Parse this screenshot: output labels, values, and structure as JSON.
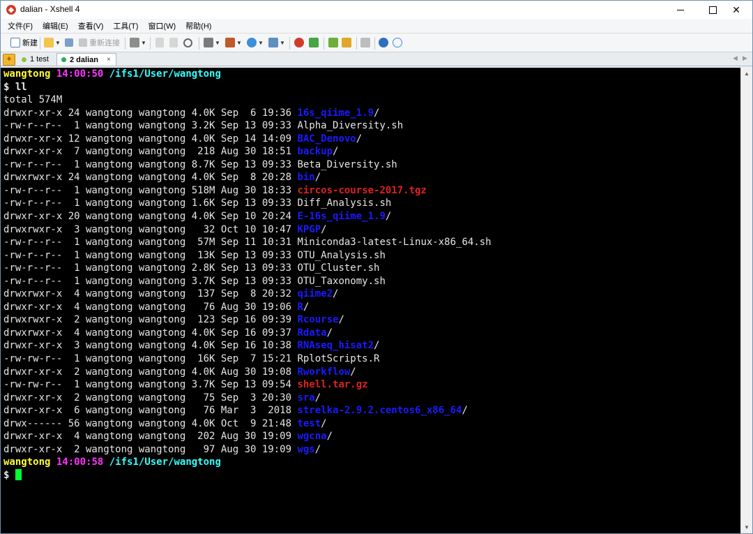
{
  "window": {
    "title": "dalian - Xshell 4"
  },
  "menu": [
    "文件(F)",
    "编辑(E)",
    "查看(V)",
    "工具(T)",
    "窗口(W)",
    "帮助(H)"
  ],
  "toolbar": {
    "new_label": "新建",
    "reconnect_label": "重新连接"
  },
  "tabs": [
    {
      "label": "1 test",
      "status_color": "#8cc63f"
    },
    {
      "label": "2 dalian",
      "status_color": "#22b14c",
      "close": "×"
    }
  ],
  "terminal": {
    "prompt_start": {
      "user": "wangtong",
      "time": "14:00:50",
      "path": "/ifs1/User/wangtong"
    },
    "command": "$ ll",
    "total": "total 574M",
    "listing": [
      {
        "meta": "drwxr-xr-x 24 wangtong wangtong 4.0K Sep  6 19:36 ",
        "name": "16s_qiime_1.9",
        "suffix": "/",
        "kind": "dir"
      },
      {
        "meta": "-rw-r--r--  1 wangtong wangtong 3.2K Sep 13 09:33 ",
        "name": "Alpha_Diversity.sh",
        "suffix": "",
        "kind": "file"
      },
      {
        "meta": "drwxr-xr-x 12 wangtong wangtong 4.0K Sep 14 14:09 ",
        "name": "BAC_Denovo",
        "suffix": "/",
        "kind": "dir"
      },
      {
        "meta": "drwxr-xr-x  7 wangtong wangtong  218 Aug 30 18:51 ",
        "name": "backup",
        "suffix": "/",
        "kind": "dir"
      },
      {
        "meta": "-rw-r--r--  1 wangtong wangtong 8.7K Sep 13 09:33 ",
        "name": "Beta_Diversity.sh",
        "suffix": "",
        "kind": "file"
      },
      {
        "meta": "drwxrwxr-x 24 wangtong wangtong 4.0K Sep  8 20:28 ",
        "name": "bin",
        "suffix": "/",
        "kind": "dir"
      },
      {
        "meta": "-rw-r--r--  1 wangtong wangtong 518M Aug 30 18:33 ",
        "name": "circos-course-2017.tgz",
        "suffix": "",
        "kind": "archive"
      },
      {
        "meta": "-rw-r--r--  1 wangtong wangtong 1.6K Sep 13 09:33 ",
        "name": "Diff_Analysis.sh",
        "suffix": "",
        "kind": "file"
      },
      {
        "meta": "drwxr-xr-x 20 wangtong wangtong 4.0K Sep 10 20:24 ",
        "name": "E-16s_qiime_1.9",
        "suffix": "/",
        "kind": "dir"
      },
      {
        "meta": "drwxrwxr-x  3 wangtong wangtong   32 Oct 10 10:47 ",
        "name": "KPGP",
        "suffix": "/",
        "kind": "dir"
      },
      {
        "meta": "-rw-r--r--  1 wangtong wangtong  57M Sep 11 10:31 ",
        "name": "Miniconda3-latest-Linux-x86_64.sh",
        "suffix": "",
        "kind": "file"
      },
      {
        "meta": "-rw-r--r--  1 wangtong wangtong  13K Sep 13 09:33 ",
        "name": "OTU_Analysis.sh",
        "suffix": "",
        "kind": "file"
      },
      {
        "meta": "-rw-r--r--  1 wangtong wangtong 2.8K Sep 13 09:33 ",
        "name": "OTU_Cluster.sh",
        "suffix": "",
        "kind": "file"
      },
      {
        "meta": "-rw-r--r--  1 wangtong wangtong 3.7K Sep 13 09:33 ",
        "name": "OTU_Taxonomy.sh",
        "suffix": "",
        "kind": "file"
      },
      {
        "meta": "drwxrwxr-x  4 wangtong wangtong  137 Sep  8 20:32 ",
        "name": "qiime2",
        "suffix": "/",
        "kind": "dir"
      },
      {
        "meta": "drwxr-xr-x  4 wangtong wangtong   76 Aug 30 19:06 ",
        "name": "R",
        "suffix": "/",
        "kind": "dir"
      },
      {
        "meta": "drwxrwxr-x  2 wangtong wangtong  123 Sep 16 09:39 ",
        "name": "Rcourse",
        "suffix": "/",
        "kind": "dir"
      },
      {
        "meta": "drwxrwxr-x  4 wangtong wangtong 4.0K Sep 16 09:37 ",
        "name": "Rdata",
        "suffix": "/",
        "kind": "dir"
      },
      {
        "meta": "drwxr-xr-x  3 wangtong wangtong 4.0K Sep 16 10:38 ",
        "name": "RNAseq_hisat2",
        "suffix": "/",
        "kind": "dir"
      },
      {
        "meta": "-rw-rw-r--  1 wangtong wangtong  16K Sep  7 15:21 ",
        "name": "RplotScripts.R",
        "suffix": "",
        "kind": "file"
      },
      {
        "meta": "drwxr-xr-x  2 wangtong wangtong 4.0K Aug 30 19:08 ",
        "name": "Rworkflow",
        "suffix": "/",
        "kind": "dir"
      },
      {
        "meta": "-rw-rw-r--  1 wangtong wangtong 3.7K Sep 13 09:54 ",
        "name": "shell.tar.gz",
        "suffix": "",
        "kind": "archive"
      },
      {
        "meta": "drwxr-xr-x  2 wangtong wangtong   75 Sep  3 20:30 ",
        "name": "sra",
        "suffix": "/",
        "kind": "dir"
      },
      {
        "meta": "drwxr-xr-x  6 wangtong wangtong   76 Mar  3  2018 ",
        "name": "strelka-2.9.2.centos6_x86_64",
        "suffix": "/",
        "kind": "dir"
      },
      {
        "meta": "drwx------ 56 wangtong wangtong 4.0K Oct  9 21:48 ",
        "name": "test",
        "suffix": "/",
        "kind": "dir"
      },
      {
        "meta": "drwxr-xr-x  4 wangtong wangtong  202 Aug 30 19:09 ",
        "name": "wgcna",
        "suffix": "/",
        "kind": "dir"
      },
      {
        "meta": "drwxr-xr-x  2 wangtong wangtong   97 Aug 30 19:09 ",
        "name": "wgs",
        "suffix": "/",
        "kind": "dir"
      }
    ],
    "prompt_end": {
      "user": "wangtong",
      "time": "14:00:58",
      "path": "/ifs1/User/wangtong"
    },
    "final_prompt": "$ ",
    "colors": {
      "directory": "#1a1aff",
      "archive": "#e02020",
      "user": "#ffff33",
      "time": "#ff33ff",
      "path": "#33ffff",
      "cursor": "#00ff33"
    }
  }
}
